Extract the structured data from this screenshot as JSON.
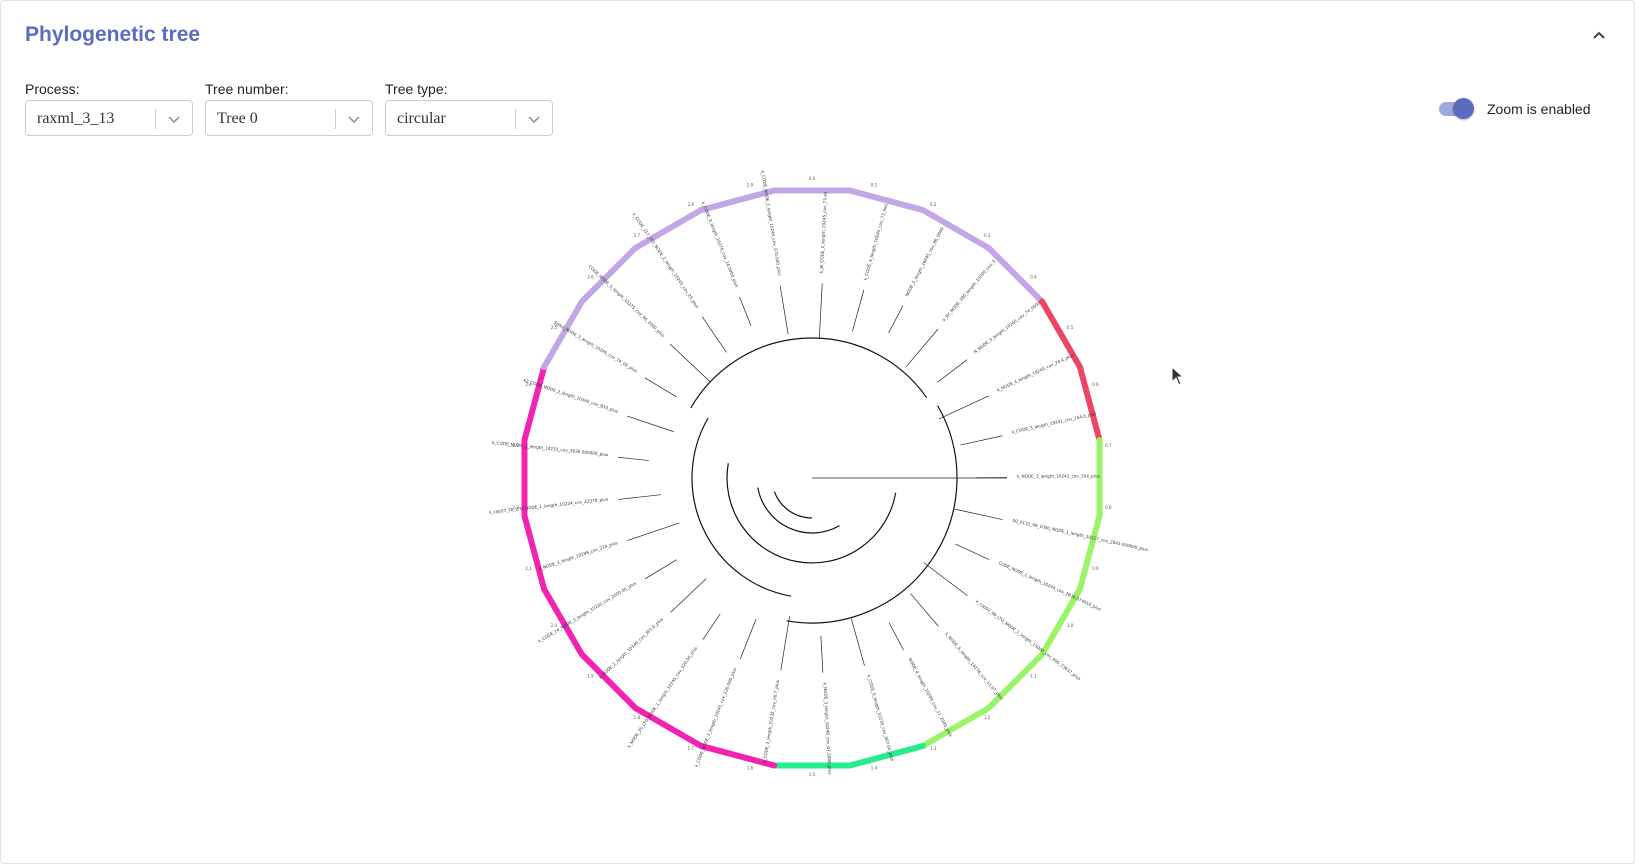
{
  "panel": {
    "title": "Phylogenetic tree"
  },
  "controls": {
    "process": {
      "label": "Process:",
      "value": "raxml_3_13"
    },
    "tree_number": {
      "label": "Tree number:",
      "value": "Tree 0"
    },
    "tree_type": {
      "label": "Tree type:",
      "value": "circular"
    },
    "zoom": {
      "label": "Zoom is enabled",
      "enabled": true
    }
  },
  "colors": {
    "accent": "#5c6bc0",
    "ring_segments": [
      "#c3a6e6",
      "#ef4565",
      "#9bf36a",
      "#27ec8e",
      "#f223b0"
    ]
  },
  "tree": {
    "leaves": [
      "k_Bl_CODE_2_length_10245_cov_73.45",
      "k_CODE_4_length_10245_cov_73_bwL",
      "NODE_2_length_16045_cov_86_0000",
      "k_RY_NODE_180_length_15000_cov_1",
      "N_NODE_3_length_10240_cov_74_0003",
      "k_NODE_4_length_19245_cov_74.4_plus",
      "k_CODE_3_length_19241_cov_154.0_plus",
      "k_NODE_3_length_10241_cov_354_plus",
      "00_0132_99_1000_NODE_1_length_10217_cov_2841.000000_plus",
      "CODE_NODE_1_length_10244_cov_2836.074910_plus",
      "k_cop02_99_LTO_NODE_1_length_15000_cov_495_73637_plus",
      "k_NODE_4_length_19276_cov_11.07_plus",
      "NODE_4_length_10299_cov_27_2000_plus",
      "k_CODE_5_length_10230_cov_907.00_plus",
      "k_NODE_3_length_10240_cov_07.2000_plus",
      "k_CODE_3_length_10232_cov_00.7_plus",
      "k_CODE_NODE_1_length_10245_cov_230.000_plus",
      "k_NODE_35_LTO_NODE_1_length_10245_cov_320.00_plus",
      "k_NODE_2_length_10340_cov_301.0_plus",
      "k_CODE_14_NODE_3_length_10232_cov_2000.00_plus",
      "k_NODE_3_length_10299_cov_224_plus",
      "k_cop27_TA_LTO_NODE_1_length_10224_cov_22378_plus",
      "k_CODE_NODE_1_length_10232_cov_3830.000000_plus",
      "k2_CODE_NODE_2_length_10340_cov_833_plus",
      "Spike_NODE_3_length_10245_cov_74_00_plus",
      "CODE_NODE_5_length_10275_cov_48_2000_plus",
      "k_CODE_217_LTO_NODE_2_length_10245_cov_25_plus",
      "k_CODE_3_length_10276_cov_14.0000_plus",
      "k_CODE_NODE_1_length_10245_cov_370.000_plus"
    ],
    "ring_ticks": [
      "0.0",
      "0.1",
      "0.2",
      "0.3",
      "0.4",
      "0.5",
      "0.6",
      "0.7",
      "0.8",
      "0.9",
      "1.0",
      "1.1",
      "1.2",
      "1.3",
      "1.4",
      "1.5",
      "1.6",
      "1.7",
      "1.8",
      "1.9",
      "2.0",
      "2.1",
      "2.2",
      "2.3",
      "2.4",
      "2.5",
      "2.6",
      "2.7",
      "2.8",
      "2.9"
    ]
  }
}
